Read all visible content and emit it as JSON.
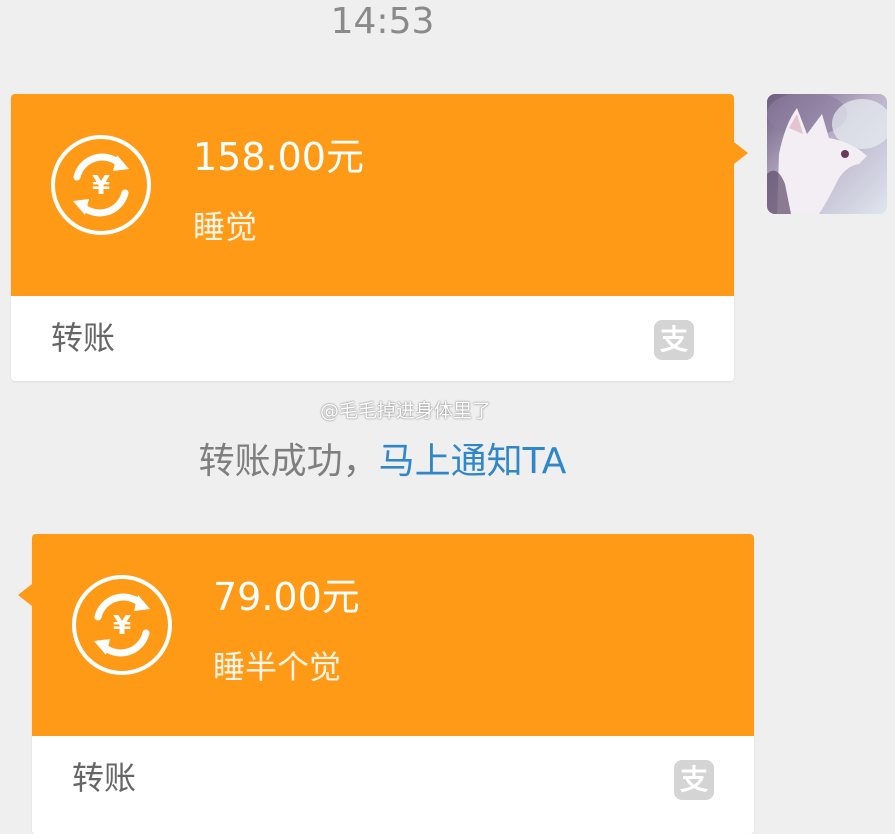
{
  "timestamp": "14:53",
  "messages": [
    {
      "amount": "158.00元",
      "memo": "睡觉",
      "footer_label": "转账",
      "coin_icon": "transfer-yuan-icon",
      "footer_icon": "alipay-icon",
      "footer_icon_glyph": "支"
    },
    {
      "amount": "79.00元",
      "memo": "睡半个觉",
      "footer_label": "转账",
      "coin_icon": "transfer-yuan-icon",
      "footer_icon": "alipay-icon",
      "footer_icon_glyph": "支"
    }
  ],
  "notice": {
    "status_text": "转账成功，",
    "link_text": "马上通知TA"
  },
  "watermark": "@毛毛掉进身体里了",
  "colors": {
    "card_orange": "#fe9a16",
    "link_blue": "#2f87c9",
    "background": "#efeff0"
  }
}
